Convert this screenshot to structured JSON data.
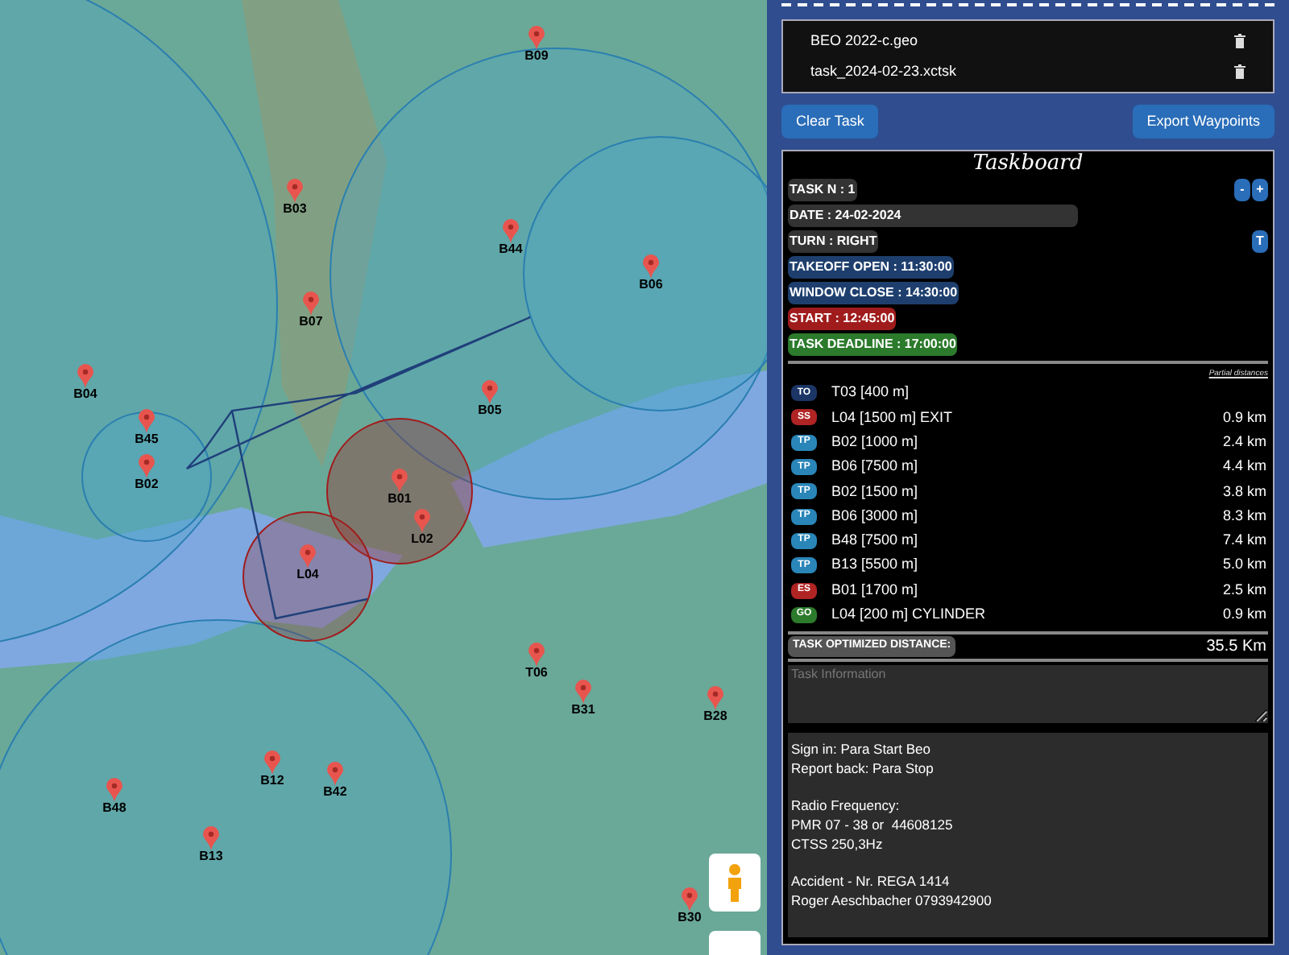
{
  "map": {
    "waypoints": [
      {
        "label": "B09"
      },
      {
        "label": "B03"
      },
      {
        "label": "B44"
      },
      {
        "label": "B06"
      },
      {
        "label": "B07"
      },
      {
        "label": "B04"
      },
      {
        "label": "B05"
      },
      {
        "label": "B45"
      },
      {
        "label": "B02"
      },
      {
        "label": "B01"
      },
      {
        "label": "L02"
      },
      {
        "label": "L04"
      },
      {
        "label": "T06"
      },
      {
        "label": "B31"
      },
      {
        "label": "B28"
      },
      {
        "label": "B12"
      },
      {
        "label": "B42"
      },
      {
        "label": "B48"
      },
      {
        "label": "B13"
      },
      {
        "label": "B30"
      }
    ]
  },
  "files": [
    {
      "name": "BEO 2022-c.geo"
    },
    {
      "name": "task_2024-02-23.xctsk"
    }
  ],
  "buttons": [
    {
      "label": "Clear Task"
    },
    {
      "label": "Export Waypoints"
    }
  ],
  "taskboard": {
    "title": "Taskboard",
    "fields": [
      {
        "text": "TASK N : 1",
        "kind": "grey",
        "controls": [
          "-",
          "+"
        ]
      },
      {
        "text": "DATE : 24-02-2024",
        "kind": "input"
      },
      {
        "text": "TURN : RIGHT",
        "kind": "grey",
        "controls": [
          "T"
        ]
      },
      {
        "text": "TAKEOFF OPEN : 11:30:00",
        "kind": "blue"
      },
      {
        "text": "WINDOW CLOSE : 14:30:00",
        "kind": "blue"
      },
      {
        "text": "START : 12:45:00",
        "kind": "red"
      },
      {
        "text": "TASK DEADLINE : 17:00:00",
        "kind": "green"
      }
    ],
    "partial_label": "Partial distances",
    "turnpoints": [
      {
        "badge": "TO",
        "kind": "takeoff",
        "name": "T03 [400 m]"
      },
      {
        "badge": "SS",
        "kind": "start",
        "name": "L04 [1500 m] EXIT",
        "distance": "0.9 km"
      },
      {
        "badge": "TP",
        "kind": "turnpoint",
        "name": "B02 [1000 m]",
        "distance": "2.4 km"
      },
      {
        "badge": "TP",
        "kind": "turnpoint",
        "name": "B06 [7500 m]",
        "distance": "4.4 km"
      },
      {
        "badge": "TP",
        "kind": "turnpoint",
        "name": "B02 [1500 m]",
        "distance": "3.8 km"
      },
      {
        "badge": "TP",
        "kind": "turnpoint",
        "name": "B06 [3000 m]",
        "distance": "8.3 km"
      },
      {
        "badge": "TP",
        "kind": "turnpoint",
        "name": "B48 [7500 m]",
        "distance": "7.4 km"
      },
      {
        "badge": "TP",
        "kind": "turnpoint",
        "name": "B13 [5500 m]",
        "distance": "5.0 km"
      },
      {
        "badge": "ES",
        "kind": "start",
        "name": "B01 [1700 m]",
        "distance": "2.5 km"
      },
      {
        "badge": "GO",
        "kind": "goal",
        "name": "L04 [200 m] CYLINDER",
        "distance": "0.9 km"
      }
    ],
    "optimized_label": "TASK OPTIMIZED DISTANCE:",
    "optimized_value": "35.5 Km",
    "info_placeholder": "Task Information",
    "notes": [
      [
        "Sign in: Para Start Beo",
        "Report back: Para Stop"
      ],
      [
        "Radio Frequency:",
        "PMR 07 - 38 or  44608125",
        "CTSS 250,3Hz"
      ],
      [
        "Accident - Nr. REGA 1414",
        "Roger Aeschbacher 0793942900"
      ]
    ]
  }
}
